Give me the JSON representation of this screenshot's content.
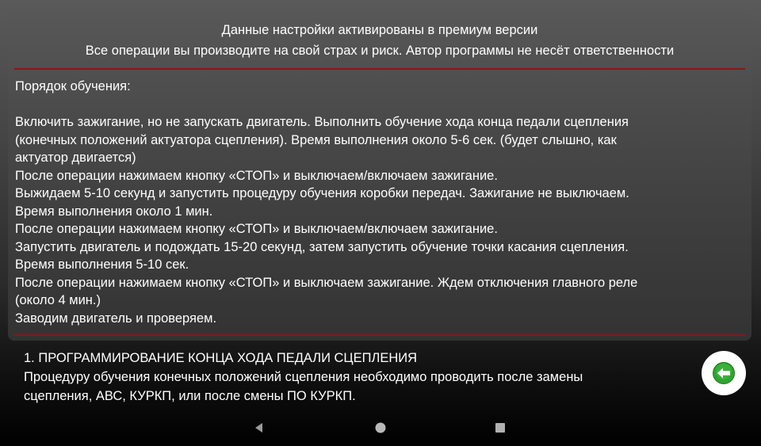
{
  "header": {
    "line1": "Данные настройки активированы в премиум версии",
    "line2": "Все операции вы производите на свой страх и риск. Автор программы не несёт ответственности"
  },
  "instructions": {
    "title": "Порядок обучения:",
    "lines": [
      " Включить зажигание, но не запускать двигатель. Выполнить обучение хода конца педали сцепления",
      "(конечных положений актуатора сцепления). Время выполнения около 5-6 сек. (будет слышно, как",
      "актуатор двигается)",
      " После операции нажимаем кнопку «СТОП» и выключаем/включаем зажигание.",
      " Выжидаем 5-10 секунд и запустить процедуру обучения коробки передач. Зажигание не выключаем.",
      "Время выполнения около 1 мин.",
      " После операции нажимаем кнопку «СТОП» и выключаем/включаем зажигание.",
      " Запустить двигатель и подождать 15-20 секунд, затем  запустить обучение точки касания сцепления.",
      "Время выполнения 5-10 сек.",
      " После операции нажимаем кнопку «СТОП» и выключаем зажигание. Ждем отключения главного реле",
      "(около 4 мин.)",
      " Заводим двигатель и проверяем."
    ]
  },
  "section": {
    "title": "1. ПРОГРАММИРОВАНИЕ КОНЦА ХОДА ПЕДАЛИ СЦЕПЛЕНИЯ",
    "desc_line1": "Процедуру обучения конечных положений сцепления необходимо проводить после замены",
    "desc_line2": "сцепления, АВС, КУРКП, или после смены ПО КУРКП."
  },
  "icons": {
    "back": "arrow-left-circle-icon",
    "nav_back": "triangle-back-icon",
    "nav_home": "circle-home-icon",
    "nav_recents": "square-recents-icon"
  },
  "colors": {
    "divider": "#8c1515",
    "accent_green": "#2fa42f"
  }
}
